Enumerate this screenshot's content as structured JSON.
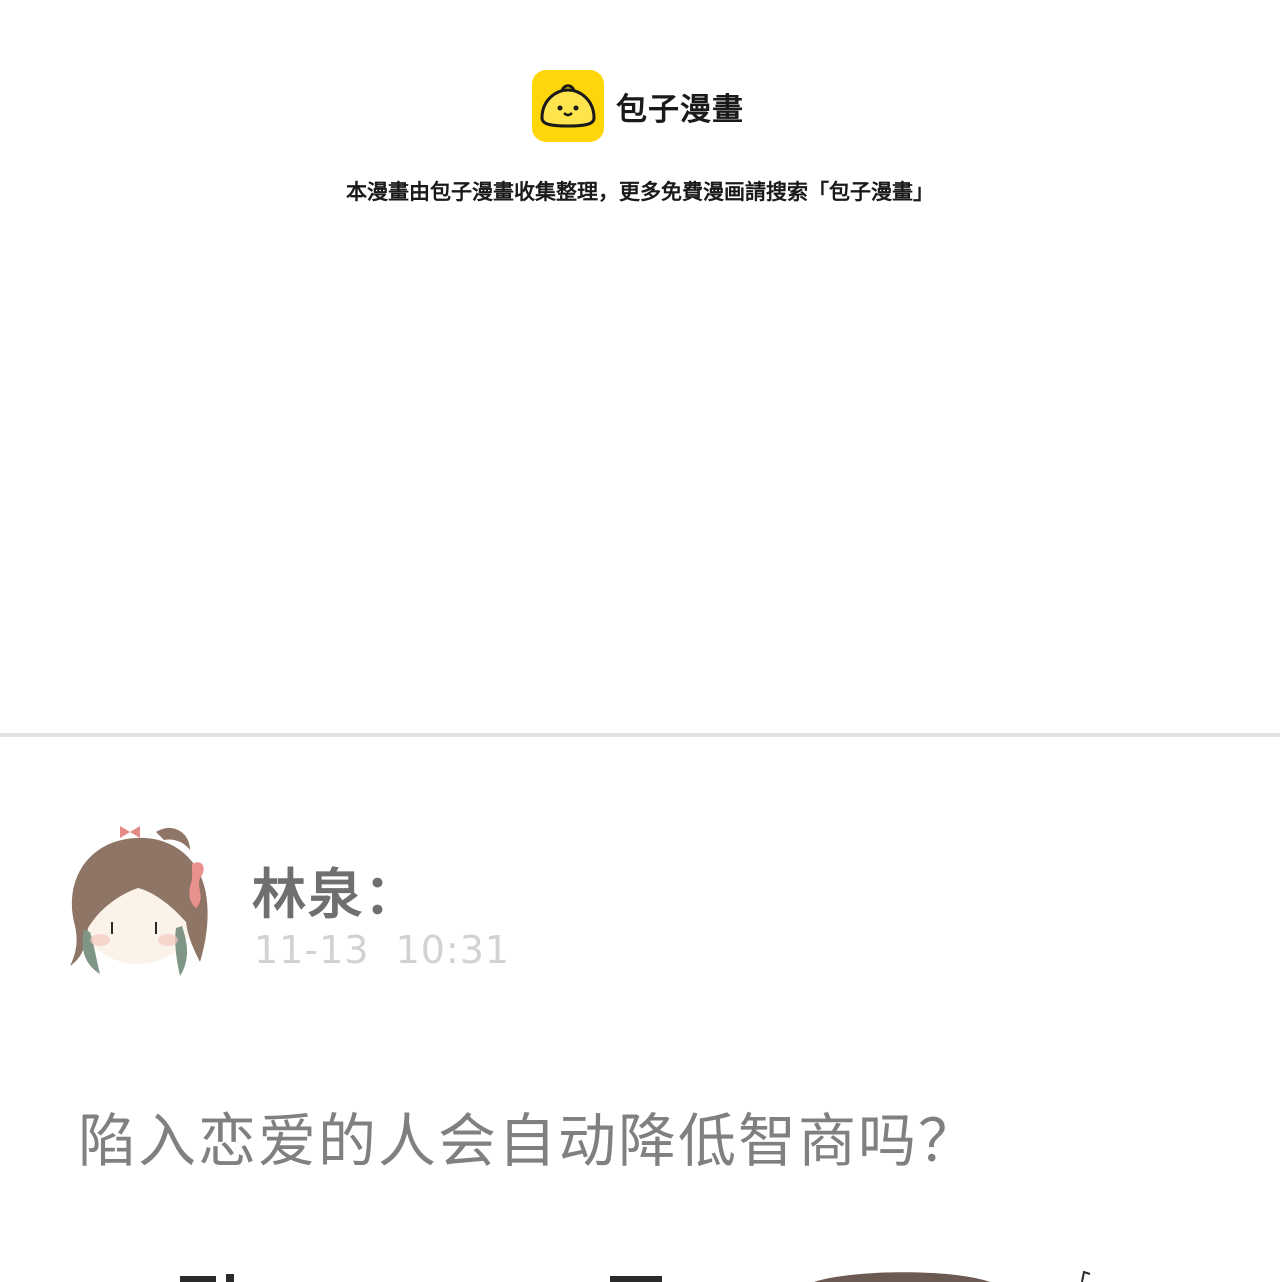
{
  "header": {
    "brand_name": "包子漫畫",
    "logo_icon": "steamed-bun-icon",
    "notice": "本漫畫由包子漫畫收集整理，更多免費漫画請搜索「包子漫畫」",
    "logo_color": "#ffd60a"
  },
  "post": {
    "author": "林泉：",
    "timestamp": "11-13  10:31",
    "question": "陷入恋爱的人会自动降低智商吗？",
    "avatar_icon": "girl-avatar-icon"
  }
}
